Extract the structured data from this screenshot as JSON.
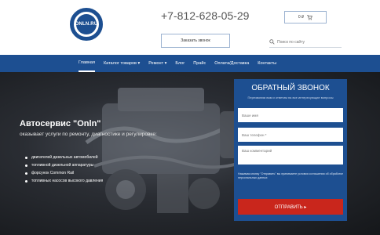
{
  "header": {
    "logo_text": "ONLN.RU",
    "phone": "+7-812-628-05-29",
    "callback_button": "Заказать звонок",
    "cart_label": "0 ₽",
    "search_placeholder": "Поиск по сайту"
  },
  "nav": {
    "items": [
      {
        "label": "Главная",
        "active": true
      },
      {
        "label": "Каталог товаров ▾"
      },
      {
        "label": "Ремонт ▾"
      },
      {
        "label": "Блог"
      },
      {
        "label": "Прайс"
      },
      {
        "label": "Оплата/Доставка"
      },
      {
        "label": "Контакты"
      }
    ]
  },
  "hero": {
    "title": "Автосервис \"Onln\"",
    "subtitle": "оказывает услуги по ремонту, диагностике и регулировке:",
    "list": [
      "двигателей дизельных автомобилей",
      "топливной дизельной аппаратуры",
      "форсунок Common Rail",
      "топливных насосов высокого давления"
    ]
  },
  "form": {
    "title": "ОБРАТНЫЙ ЗВОНОК",
    "subtitle": "Перезвоним вам и ответим на все интересующие вопросы",
    "name_placeholder": "Ваше имя",
    "phone_placeholder": "Ваш телефон *",
    "comment_placeholder": "Ваш комментарий",
    "note": "Нажимая кнопку \"Отправить\" вы принимаете условия соглашения об обработке персональных данных",
    "submit": "ОТПРАВИТЬ ▸"
  },
  "colors": {
    "brand_blue": "#1d4f91",
    "submit_red": "#c9261c"
  }
}
